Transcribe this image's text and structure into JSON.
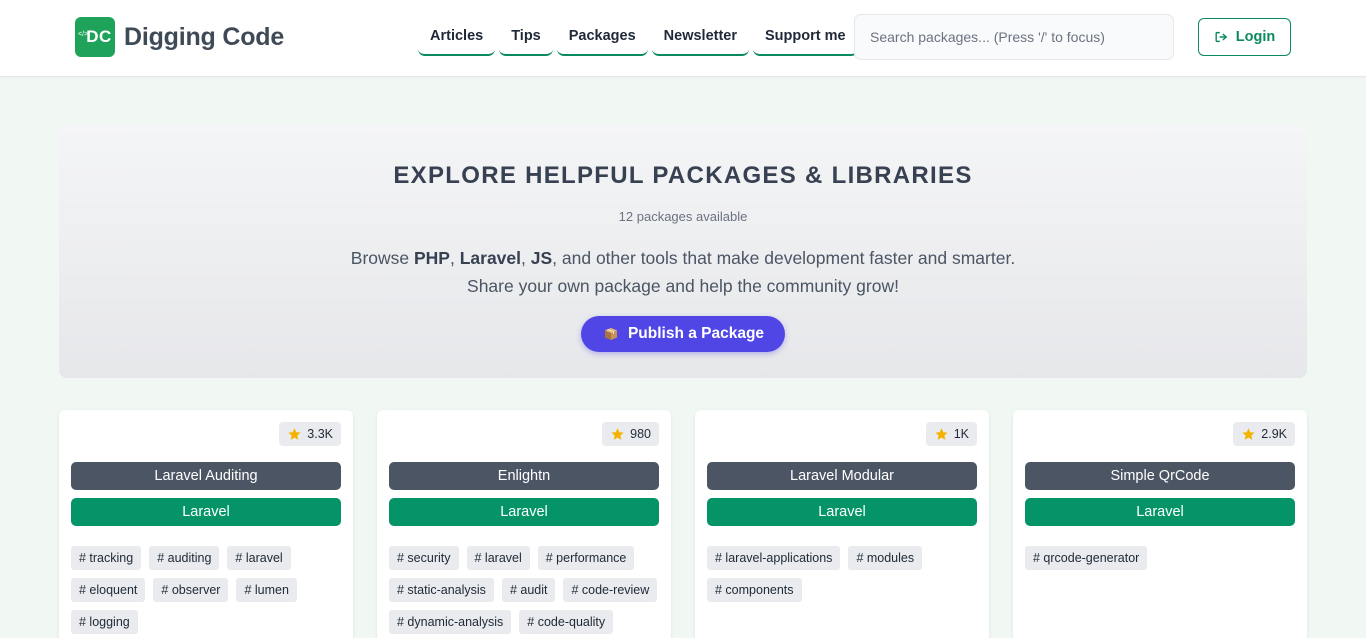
{
  "brand": {
    "badge": "DC",
    "badge_mark": "</>",
    "name": "Digging Code",
    "color": "#1fa35a"
  },
  "nav": [
    {
      "label": "Articles"
    },
    {
      "label": "Tips"
    },
    {
      "label": "Packages"
    },
    {
      "label": "Newsletter"
    },
    {
      "label": "Support me"
    }
  ],
  "search": {
    "placeholder": "Search packages... (Press '/' to focus)",
    "value": ""
  },
  "login": {
    "label": "Login",
    "icon": "login-icon"
  },
  "hero": {
    "title": "EXPLORE HELPFUL PACKAGES & LIBRARIES",
    "count": "12 packages available",
    "line1_prefix": "Browse ",
    "php": "PHP",
    "sep1": ", ",
    "laravel": "Laravel",
    "sep2": ", ",
    "js": "JS",
    "line1_suffix": ", and other tools that make development faster and smarter.",
    "line2": "Share your own package and help the community grow!",
    "publish_label": "Publish a Package",
    "publish_icon": "package-box-icon",
    "publish_color": "#4f46e5"
  },
  "packages": [
    {
      "stars": "3.3K",
      "name": "Laravel Auditing",
      "category": "Laravel",
      "tags": [
        "# tracking",
        "# auditing",
        "# laravel",
        "# eloquent",
        "# observer",
        "# lumen",
        "# logging"
      ]
    },
    {
      "stars": "980",
      "name": "Enlightn",
      "category": "Laravel",
      "tags": [
        "# security",
        "# laravel",
        "# performance",
        "# static-analysis",
        "# audit",
        "# code-review",
        "# dynamic-analysis",
        "# code-quality"
      ]
    },
    {
      "stars": "1K",
      "name": "Laravel Modular",
      "category": "Laravel",
      "tags": [
        "# laravel-applications",
        "# modules",
        "# components"
      ]
    },
    {
      "stars": "2.9K",
      "name": "Simple QrCode",
      "category": "Laravel",
      "tags": [
        "# qrcode-generator"
      ]
    }
  ],
  "colors": {
    "category": "#049467",
    "name_bg": "#4b5563",
    "accent": "#0b8a5e",
    "star": "#f5b301"
  }
}
